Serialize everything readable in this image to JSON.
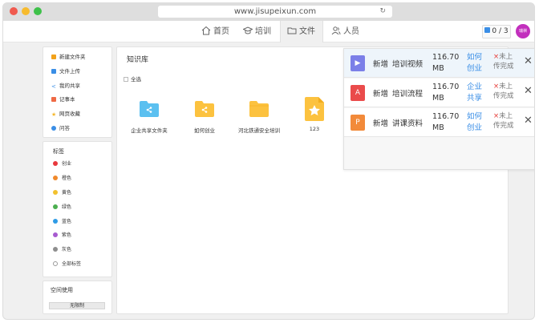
{
  "browser": {
    "url": "www.jisupeixun.com"
  },
  "nav": {
    "items": [
      {
        "label": "首页",
        "icon": "home-icon"
      },
      {
        "label": "培训",
        "icon": "graduation-cap-icon"
      },
      {
        "label": "文件",
        "icon": "folder-icon",
        "active": true
      },
      {
        "label": "人员",
        "icon": "people-icon"
      }
    ],
    "upload_count": "0 / 3",
    "avatar_text": "瑞祺"
  },
  "sidebar": {
    "actions": [
      {
        "label": "新建文件夹",
        "color": "#f2a21b"
      },
      {
        "label": "文件上传",
        "color": "#3a8ee6"
      },
      {
        "label": "我的共享",
        "color": "#3a8ee6"
      },
      {
        "label": "记事本",
        "color": "#ef6a45"
      },
      {
        "label": "网页收藏",
        "color": "#f5b82e"
      },
      {
        "label": "问答",
        "color": "#3a8ee6"
      }
    ],
    "tags_title": "标签",
    "tags": [
      {
        "label": "创业",
        "color": "#e8383d"
      },
      {
        "label": "橙色",
        "color": "#f0892b"
      },
      {
        "label": "黄色",
        "color": "#f2c12e"
      },
      {
        "label": "绿色",
        "color": "#4caf50"
      },
      {
        "label": "蓝色",
        "color": "#2e9be6"
      },
      {
        "label": "紫色",
        "color": "#a75bd0"
      },
      {
        "label": "灰色",
        "color": "#8e8e8e"
      },
      {
        "label": "全部标签",
        "color": "#ffffff"
      }
    ],
    "space_title": "空间使用",
    "space_value": "无限制"
  },
  "main": {
    "title": "知识库",
    "select_all": "全选",
    "files": [
      {
        "name": "企业共享文件夹",
        "type": "shared-folder"
      },
      {
        "name": "如何创业",
        "type": "shared-folder-yellow"
      },
      {
        "name": "河北铁通安全培训",
        "type": "folder"
      },
      {
        "name": "123",
        "type": "starred-file"
      }
    ]
  },
  "uploads": [
    {
      "action": "新增",
      "name": "培训视频",
      "size": "116.70 MB",
      "dest": "如何创业",
      "status_mark": "×",
      "status": "未上传完成",
      "icon": "video-file-icon",
      "icon_char": "▶",
      "color": "#7b7fe8"
    },
    {
      "action": "新增",
      "name": "培训流程",
      "size": "116.70 MB",
      "dest": "企业共享",
      "status_mark": "×",
      "status": "未上传完成",
      "icon": "pdf-file-icon",
      "icon_char": "A",
      "color": "#ea4b4b"
    },
    {
      "action": "新增",
      "name": "讲课资料",
      "size": "116.70 MB",
      "dest": "如何创业",
      "status_mark": "×",
      "status": "未上传完成",
      "icon": "ppt-file-icon",
      "icon_char": "P",
      "color": "#f28a3a"
    }
  ],
  "colors": {
    "accent": "#3a8ee6",
    "folder": "#fcc23f",
    "shared_folder": "#5bc0f0"
  }
}
